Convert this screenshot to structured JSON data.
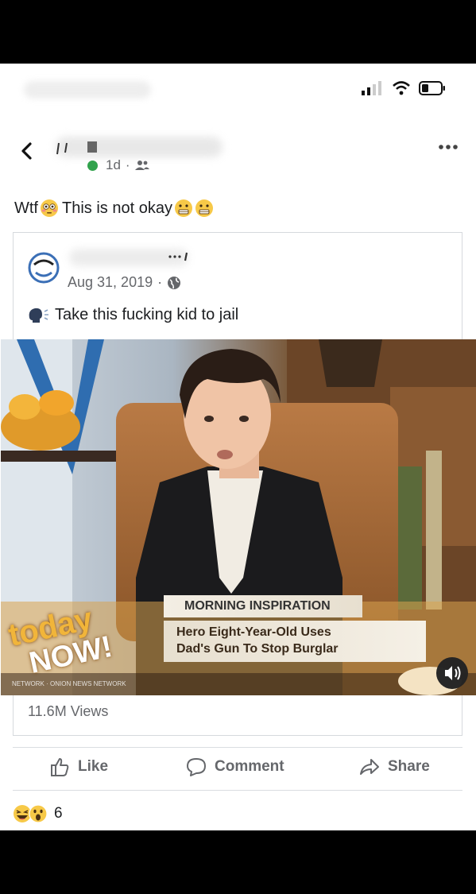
{
  "post": {
    "time": "1d",
    "separator": "·",
    "text": "Wtf",
    "text_after": "This is not okay"
  },
  "shared_post": {
    "date": "Aug 31, 2019",
    "separator": "·",
    "text": "Take this fucking kid to jail",
    "views": "11.6M Views"
  },
  "video": {
    "lower_third_label": "MORNING INSPIRATION",
    "headline_line1": "Hero Eight-Year-Old Uses",
    "headline_line2": "Dad's Gun To Stop Burglar",
    "logo_line1": "today",
    "logo_line2": "NOW!",
    "network_text": "NETWORK · ONION NEWS NETWORK"
  },
  "actions": {
    "like": "Like",
    "comment": "Comment",
    "share": "Share"
  },
  "reactions": {
    "count": "6"
  },
  "colors": {
    "online": "#31a24c",
    "secondary_text": "#65676b",
    "accent_gold": "#f0a020"
  }
}
